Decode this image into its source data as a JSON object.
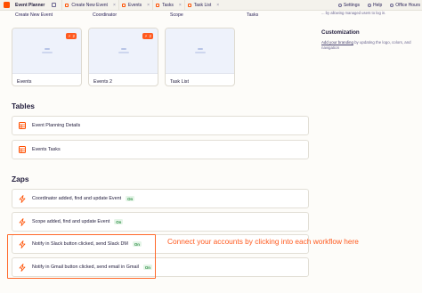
{
  "app": {
    "name": "Event Planner"
  },
  "tabs": [
    {
      "label": "Create New Event"
    },
    {
      "label": "Events"
    },
    {
      "label": "Tasks"
    },
    {
      "label": "Task List"
    }
  ],
  "tab_close_glyph": "×",
  "topbar_right": [
    {
      "label": "Settings",
      "icon": "gear-icon"
    },
    {
      "label": "Help",
      "icon": "help-icon"
    },
    {
      "label": "Office Hours",
      "icon": "calendar-icon"
    }
  ],
  "interfaces_top": [
    "Create New Event",
    "Coordinator",
    "Scope",
    "Tasks"
  ],
  "interfaces": [
    {
      "label": "Events",
      "badge": "2"
    },
    {
      "label": "Events 2",
      "badge": "2"
    },
    {
      "label": "Task List",
      "badge": ""
    }
  ],
  "sidebar": {
    "top_text": "... by allowing managed users to log in.",
    "customization_heading": "Customization",
    "customization_link": "Add your branding",
    "customization_rest": " by updating the logo, colors, and navigation"
  },
  "sections": {
    "tables": "Tables",
    "zaps": "Zaps"
  },
  "tables": [
    {
      "label": "Event Planning Details"
    },
    {
      "label": "Events Tasks"
    }
  ],
  "zaps": [
    {
      "label": "Coordinator added, find and update Event",
      "status": "On"
    },
    {
      "label": "Scope added, find and update Event",
      "status": "On"
    },
    {
      "label": "Notify in Slack button clicked, send Slack DM",
      "status": "On"
    },
    {
      "label": "Notify in Gmail button clicked, send email in Gmail",
      "status": "On"
    }
  ],
  "callout": {
    "text": "Connect your accounts by clicking into each workflow here"
  },
  "colors": {
    "accent": "#ff4f00",
    "on_badge": "#2e8f46",
    "callout": "#ff5a1f"
  }
}
